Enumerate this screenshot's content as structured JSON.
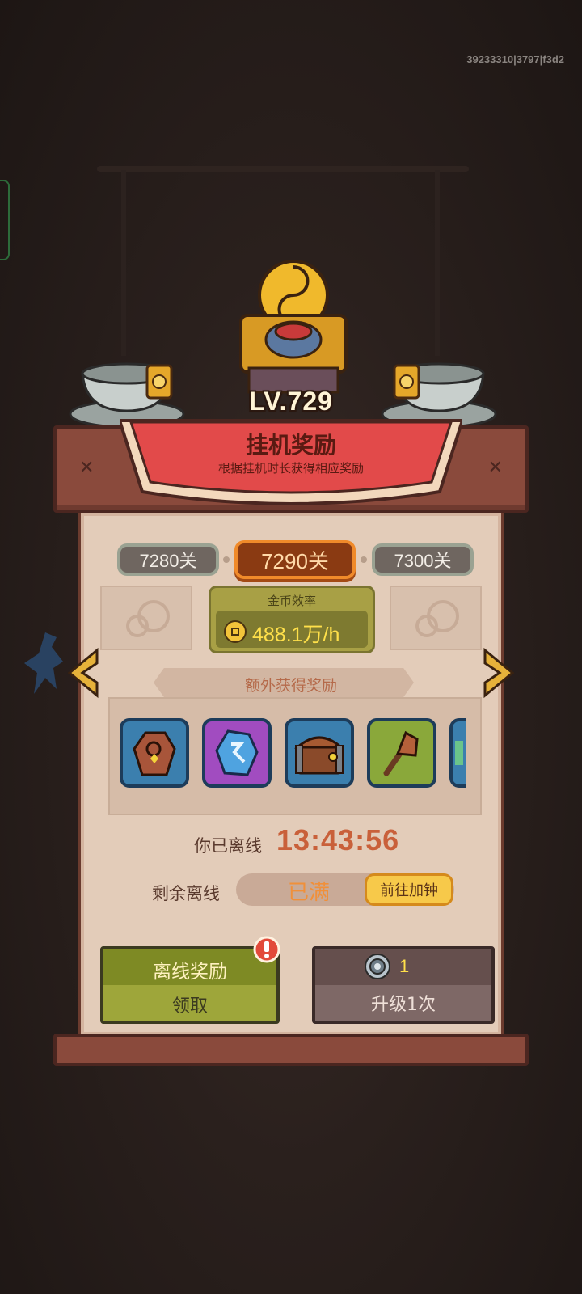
{
  "debug": {
    "device_id": "39233310|3797|f3d2"
  },
  "header": {
    "level": "LV.729",
    "title": "挂机奖励",
    "subtitle": "根据挂机时长获得相应奖励"
  },
  "stages": [
    {
      "label": "7280关",
      "state": "previous"
    },
    {
      "label": "7290关",
      "state": "current"
    },
    {
      "label": "7300关",
      "state": "next"
    }
  ],
  "gold_rate": {
    "label": "金币效率",
    "value": "488.1万/h"
  },
  "extra_rewards": {
    "label": "额外获得奖励",
    "items": [
      {
        "icon": "coffin-icon",
        "frame_color": "#3b7fae"
      },
      {
        "icon": "rune-stone-icon",
        "frame_color": "#a14cc0"
      },
      {
        "icon": "treasure-chest-icon",
        "frame_color": "#3b7fae"
      },
      {
        "icon": "torch-icon",
        "frame_color": "#8aa83a"
      },
      {
        "icon": "partial-item-icon",
        "frame_color": "#3b7fae"
      }
    ]
  },
  "offline": {
    "elapsed_label": "你已离线",
    "elapsed_time": "13:43:56",
    "remaining_label": "剩余离线",
    "remaining_status": "已满",
    "boost_button": "前往加钟"
  },
  "actions": {
    "claim": {
      "title": "离线奖励",
      "button": "领取",
      "alert_icon": "exclamation-icon"
    },
    "upgrade": {
      "cost": "1",
      "button": "升级1次",
      "currency_icon": "gear-coin-icon"
    }
  },
  "colors": {
    "accent_orange": "#f08a2a",
    "gold_text": "#ffe04a",
    "timer": "#c9603a",
    "banner_red": "#e24a4a",
    "claim_green": "#9ea63a"
  }
}
